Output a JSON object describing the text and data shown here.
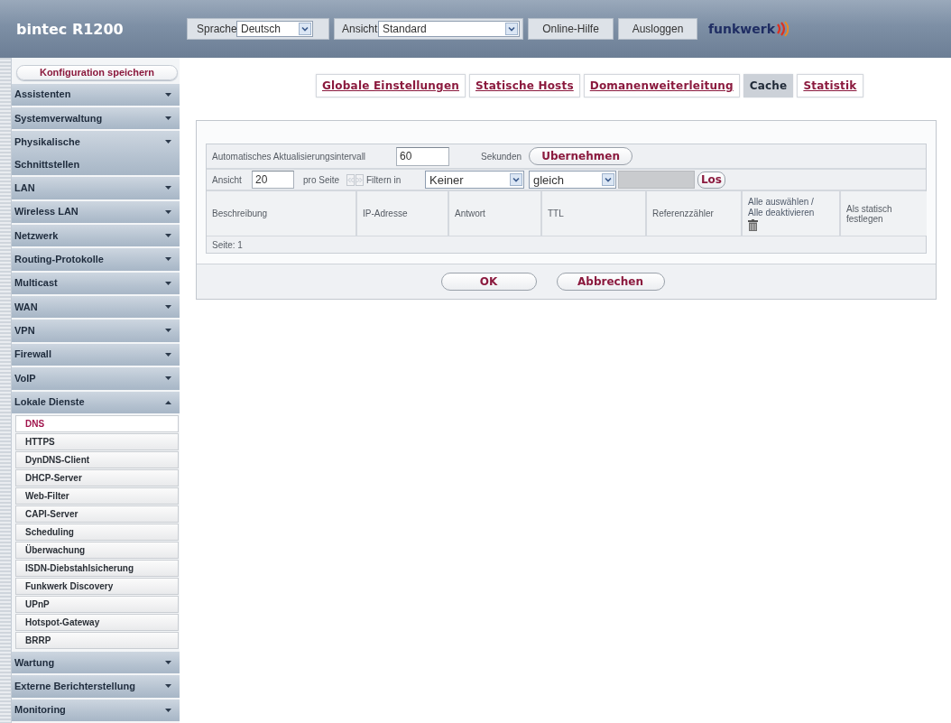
{
  "header": {
    "title": "bintec R1200",
    "language": {
      "label": "Sprache",
      "value": "Deutsch"
    },
    "view": {
      "label": "Ansicht",
      "value": "Standard"
    },
    "links": [
      "Online-Hilfe",
      "Ausloggen"
    ],
    "logo": "funkwerk"
  },
  "sidebar": {
    "save_button": "Konfiguration speichern",
    "items": [
      {
        "label": "Assistenten",
        "expanded": false
      },
      {
        "label": "Systemverwaltung",
        "expanded": false
      },
      {
        "label": "Physikalische Schnittstellen",
        "expanded": false
      },
      {
        "label": "LAN",
        "expanded": false
      },
      {
        "label": "Wireless LAN",
        "expanded": false
      },
      {
        "label": "Netzwerk",
        "expanded": false
      },
      {
        "label": "Routing-Protokolle",
        "expanded": false
      },
      {
        "label": "Multicast",
        "expanded": false
      },
      {
        "label": "WAN",
        "expanded": false
      },
      {
        "label": "VPN",
        "expanded": false
      },
      {
        "label": "Firewall",
        "expanded": false
      },
      {
        "label": "VoIP",
        "expanded": false
      },
      {
        "label": "Lokale Dienste",
        "expanded": true,
        "children": [
          {
            "label": "DNS",
            "selected": true
          },
          {
            "label": "HTTPS",
            "selected": false
          },
          {
            "label": "DynDNS-Client",
            "selected": false
          },
          {
            "label": "DHCP-Server",
            "selected": false
          },
          {
            "label": "Web-Filter",
            "selected": false
          },
          {
            "label": "CAPI-Server",
            "selected": false
          },
          {
            "label": "Scheduling",
            "selected": false
          },
          {
            "label": "Überwachung",
            "selected": false
          },
          {
            "label": "ISDN-Diebstahlsicherung",
            "selected": false
          },
          {
            "label": "Funkwerk Discovery",
            "selected": false
          },
          {
            "label": "UPnP",
            "selected": false
          },
          {
            "label": "Hotspot-Gateway",
            "selected": false
          },
          {
            "label": "BRRP",
            "selected": false
          }
        ]
      },
      {
        "label": "Wartung",
        "expanded": false
      },
      {
        "label": "Externe Berichterstellung",
        "expanded": false
      },
      {
        "label": "Monitoring",
        "expanded": false
      }
    ]
  },
  "tabs": [
    {
      "label": "Globale Einstellungen",
      "selected": false
    },
    {
      "label": "Statische Hosts",
      "selected": false
    },
    {
      "label": "Domanenweiterleitung",
      "selected": false
    },
    {
      "label": "Cache",
      "selected": true
    },
    {
      "label": "Statistik",
      "selected": false
    }
  ],
  "refresh": {
    "label": "Automatisches Aktualisierungsintervall",
    "value": "60",
    "unit": "Sekunden",
    "button": "Ubernehmen"
  },
  "filter": {
    "view_label": "Ansicht",
    "per_page": "20",
    "per_page_label": "pro Seite",
    "pager": [
      {
        "kind": "previous",
        "disabled": true
      },
      {
        "kind": "next",
        "disabled": true
      }
    ],
    "filter_label": "Filtern in",
    "field": "Keiner",
    "operator": "gleich",
    "value_field": {
      "disabled": true
    },
    "button": "Los"
  },
  "table": {
    "columns": [
      {
        "label": "Beschreibung",
        "kind": "text"
      },
      {
        "label": "IP-Adresse",
        "kind": "text"
      },
      {
        "label": "Antwort",
        "kind": "text"
      },
      {
        "label": "TTL",
        "kind": "text"
      },
      {
        "label": "Referenzzähler",
        "kind": "text"
      },
      {
        "label": "Alle auswählen / Alle deaktivieren",
        "kind": "delete"
      },
      {
        "label": "Als statisch festlegen",
        "kind": "text"
      }
    ],
    "footer": "Seite: 1"
  },
  "buttons": [
    "OK",
    "Abbrechen"
  ]
}
